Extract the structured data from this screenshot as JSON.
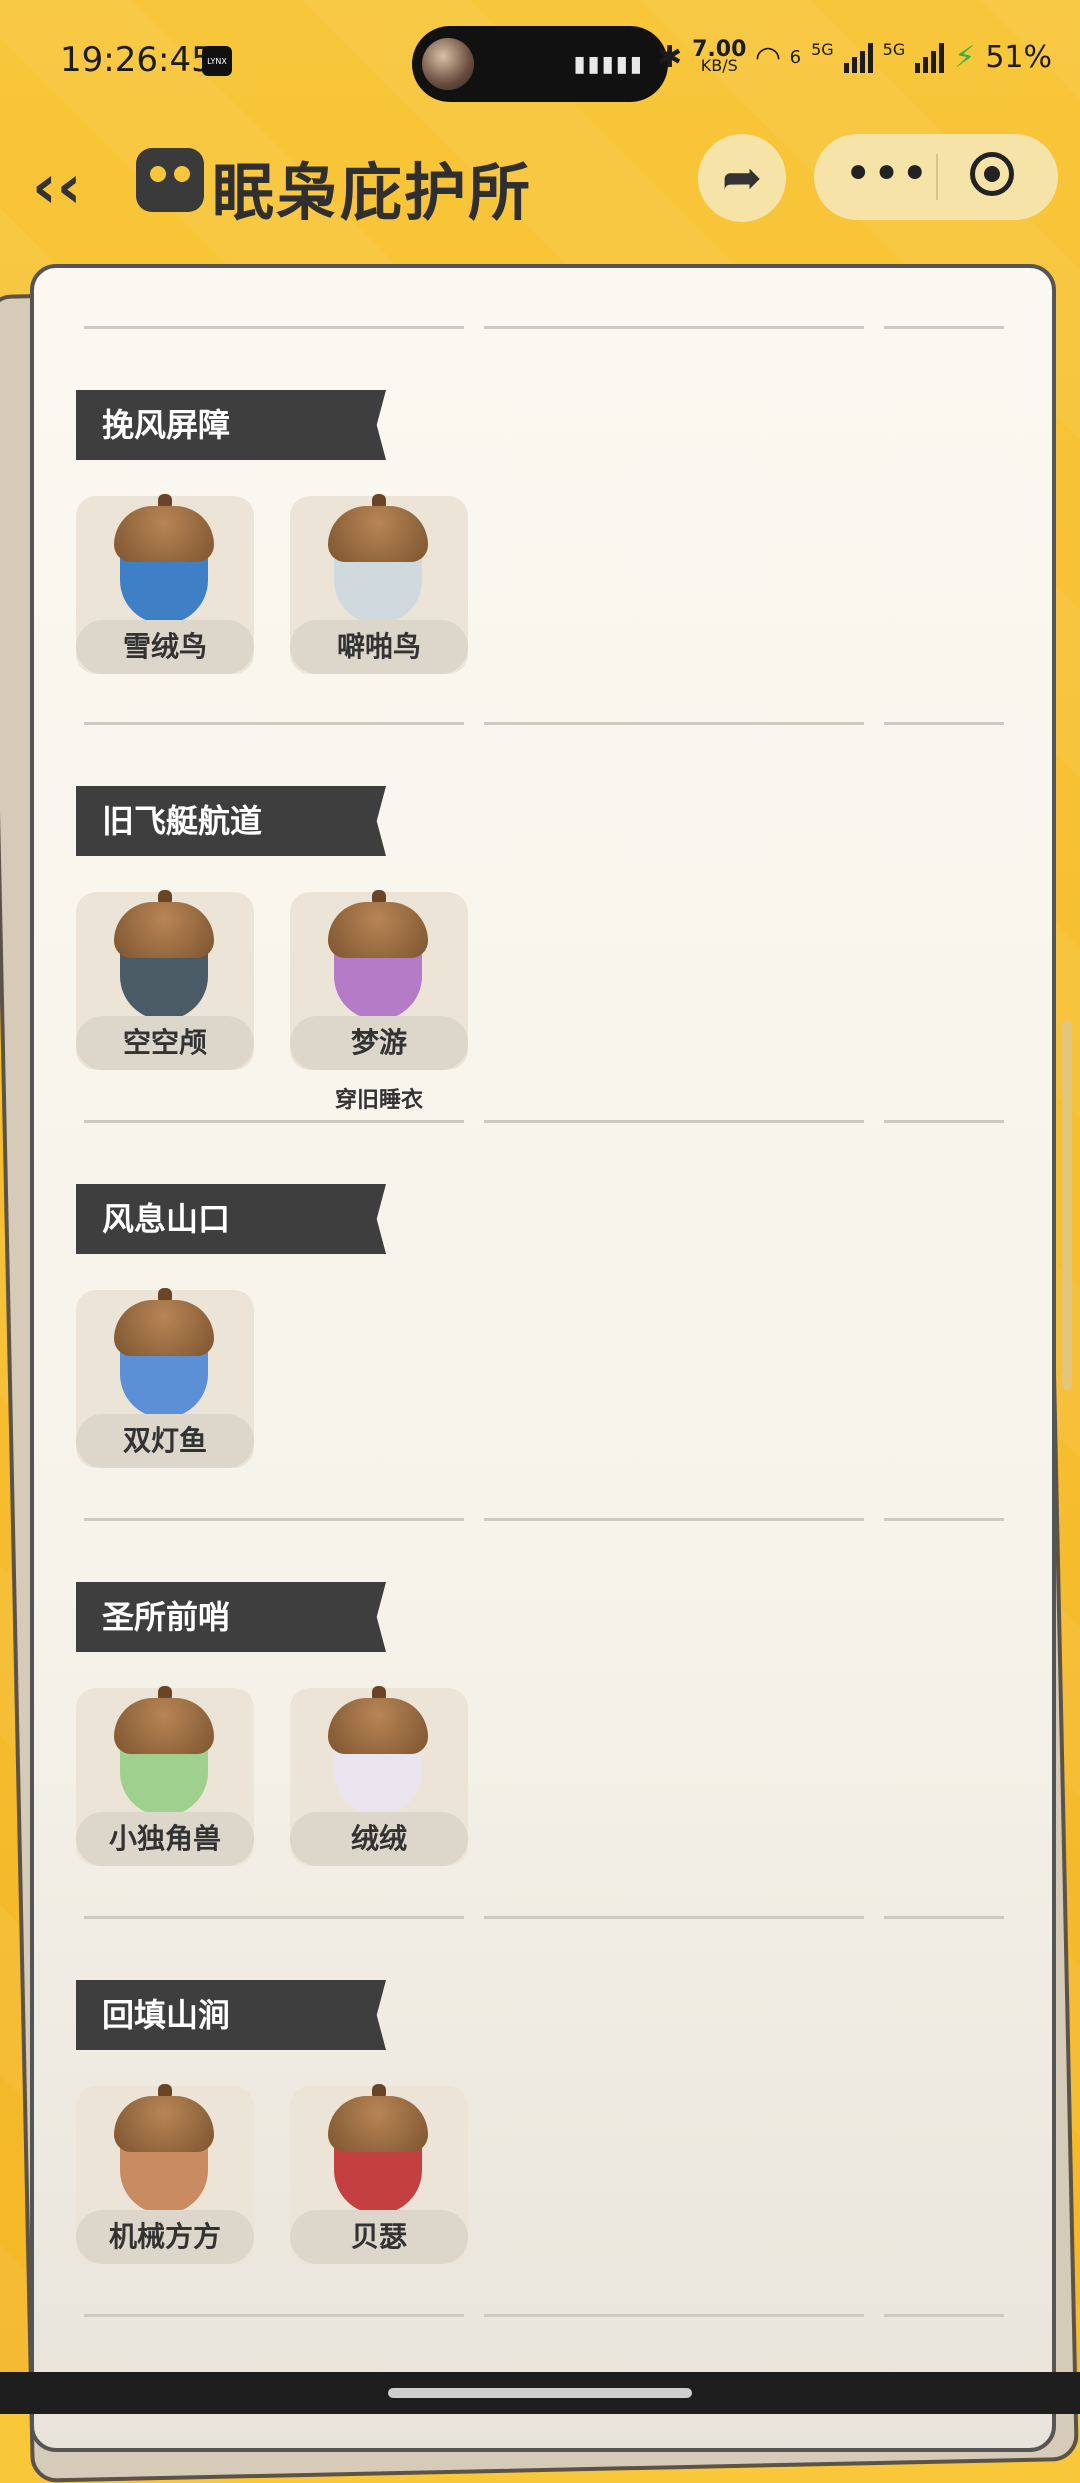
{
  "status_bar": {
    "time": "19:26:45",
    "net_speed_value": "7.00",
    "net_speed_unit": "KB/S",
    "wifi_number": "6",
    "sim1_label": "5G",
    "sim2_label": "5G",
    "battery": "51%"
  },
  "header": {
    "title": "眠枭庇护所"
  },
  "sections": [
    {
      "title": "挽风屏障",
      "items": [
        {
          "name": "雪绒鸟",
          "color": "#3f7fc6"
        },
        {
          "name": "噼啪鸟",
          "color": "#cfd9de"
        }
      ]
    },
    {
      "title": "旧飞艇航道",
      "items": [
        {
          "name": "空空颅",
          "color": "#4b5b66"
        },
        {
          "name": "梦游",
          "color": "#b67bc6",
          "note": "穿旧睡衣"
        }
      ]
    },
    {
      "title": "风息山口",
      "items": [
        {
          "name": "双灯鱼",
          "color": "#5b8fd6"
        }
      ]
    },
    {
      "title": "圣所前哨",
      "items": [
        {
          "name": "小独角兽",
          "color": "#9fd08e"
        },
        {
          "name": "绒绒",
          "color": "#e9e4ee"
        }
      ]
    },
    {
      "title": "回填山涧",
      "items": [
        {
          "name": "机械方方",
          "color": "#c98c62"
        },
        {
          "name": "贝瑟",
          "color": "#c43f3f"
        }
      ]
    }
  ]
}
